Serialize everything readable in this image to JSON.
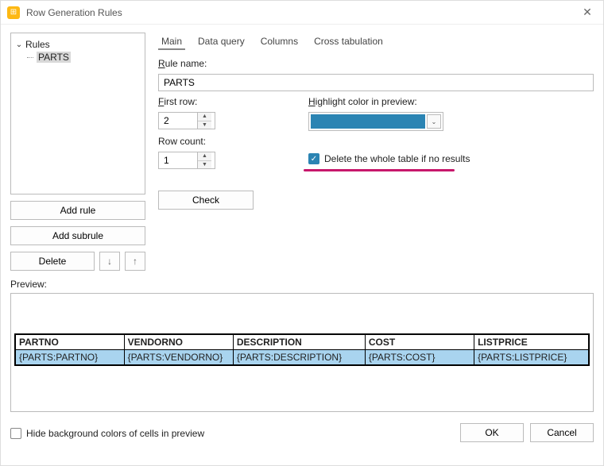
{
  "window": {
    "title": "Row Generation Rules"
  },
  "tree": {
    "root_label": "Rules",
    "items": [
      {
        "label": "PARTS"
      }
    ]
  },
  "left_buttons": {
    "add_rule": "Add rule",
    "add_subrule": "Add subrule",
    "delete": "Delete"
  },
  "tabs": {
    "items": [
      {
        "label": "Main"
      },
      {
        "label": "Data query"
      },
      {
        "label": "Columns"
      },
      {
        "label": "Cross tabulation"
      }
    ]
  },
  "form": {
    "rule_name_label": "Rule name:",
    "rule_name_value": "PARTS",
    "first_row_label": "First row:",
    "first_row_value": "2",
    "highlight_label": "Highlight color in preview:",
    "highlight_color": "#2b84b3",
    "row_count_label": "Row count:",
    "row_count_value": "1",
    "delete_table_checked": true,
    "delete_table_label": "Delete the whole table if no results",
    "check_button": "Check"
  },
  "preview": {
    "label": "Preview:",
    "columns": [
      {
        "header": "PARTNO",
        "value": "{PARTS:PARTNO}"
      },
      {
        "header": "VENDORNO",
        "value": "{PARTS:VENDORNO}"
      },
      {
        "header": "DESCRIPTION",
        "value": "{PARTS:DESCRIPTION}"
      },
      {
        "header": "COST",
        "value": "{PARTS:COST}"
      },
      {
        "header": "LISTPRICE",
        "value": "{PARTS:LISTPRICE}"
      }
    ]
  },
  "footer": {
    "hide_bg_label": "Hide background colors of cells in preview",
    "hide_bg_checked": false,
    "ok": "OK",
    "cancel": "Cancel"
  }
}
